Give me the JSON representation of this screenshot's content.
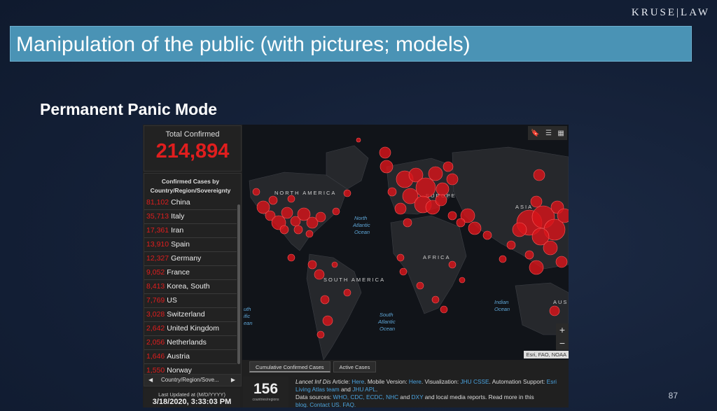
{
  "brand": "KRUSE|LAW",
  "slide_title": "Manipulation of the public (with pictures; models)",
  "subtitle": "Permanent Panic Mode",
  "page_number": "87",
  "dashboard": {
    "total_label": "Total Confirmed",
    "total_value": "214,894",
    "list_title_line1": "Confirmed Cases by",
    "list_title_line2": "Country/Region/Sovereignty",
    "countries": [
      {
        "count": "81,102",
        "name": "China"
      },
      {
        "count": "35,713",
        "name": "Italy"
      },
      {
        "count": "17,361",
        "name": "Iran"
      },
      {
        "count": "13,910",
        "name": "Spain"
      },
      {
        "count": "12,327",
        "name": "Germany"
      },
      {
        "count": "9,052",
        "name": "France"
      },
      {
        "count": "8,413",
        "name": "Korea, South"
      },
      {
        "count": "7,769",
        "name": "US"
      },
      {
        "count": "3,028",
        "name": "Switzerland"
      },
      {
        "count": "2,642",
        "name": "United Kingdom"
      },
      {
        "count": "2,056",
        "name": "Netherlands"
      },
      {
        "count": "1,646",
        "name": "Austria"
      },
      {
        "count": "1,550",
        "name": "Norway"
      }
    ],
    "pager_label": "Country/Region/Sove...",
    "last_updated_label": "Last Updated at (M/D/YYYY)",
    "last_updated_value": "3/18/2020, 3:33:03 PM",
    "countries_count": "156",
    "countries_count_label": "countries/regions",
    "tabs": [
      "Cumulative Confirmed Cases",
      "Active Cases"
    ],
    "map_credit": "Esri, FAO, NOAA",
    "zoom_in": "+",
    "zoom_out": "−",
    "info_text_1": "Lancet Inf Dis",
    "info_text_2": " Article: ",
    "info_link_here1": "Here",
    "info_text_3": ". Mobile Version: ",
    "info_link_here2": "Here",
    "info_text_4": ". Visualization: ",
    "info_link_jhu": "JHU CSSE",
    "info_text_5": ". Automation Support: ",
    "info_link_esri": "Esri Living Atlas team",
    "info_text_6": " and ",
    "info_link_apl": "JHU APL",
    "info_text_7": ".",
    "info_line3_a": "Data sources: ",
    "info_line3_links": "WHO, CDC, ECDC, NHC",
    "info_line3_b": " and ",
    "info_line3_dxy": "DXY",
    "info_line3_c": " and local media reports. Read more in this",
    "info_line4": "blog. Contact US. FAQ.",
    "map_labels": {
      "north_america": "NORTH AMERICA",
      "south_america": "SOUTH AMERICA",
      "europe": "EUROPE",
      "asia": "ASIA",
      "africa": "AFRICA",
      "australia": "AUS",
      "north_atlantic": [
        "North",
        "Atlantic",
        "Ocean"
      ],
      "south_atlantic": [
        "South",
        "Atlantic",
        "Ocean"
      ],
      "indian": [
        "Indian",
        "Ocean"
      ],
      "south_pacific": [
        "uth",
        "ific",
        "ean"
      ]
    }
  }
}
